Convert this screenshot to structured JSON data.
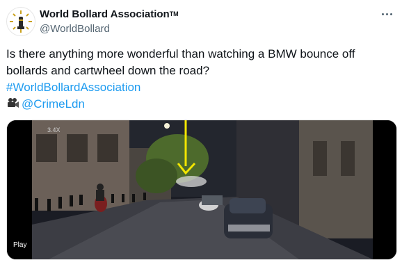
{
  "tweet": {
    "author_name": "World Bollard Association",
    "author_badge": "TM",
    "handle": "@WorldBollard",
    "text_line1": "Is there anything more wonderful than watching a BMW bounce off bollards and cartwheel down the road?",
    "hashtag": "#WorldBollardAssociation",
    "mention": "@CrimeLdn",
    "mention_icon": "movie-camera-icon",
    "more_icon": "more-options-icon"
  },
  "media": {
    "zoom_label": "3.4X",
    "play_label": "Play",
    "arrow_color": "#f2e600"
  },
  "colors": {
    "link": "#1d9bf0",
    "secondary": "#536471"
  }
}
